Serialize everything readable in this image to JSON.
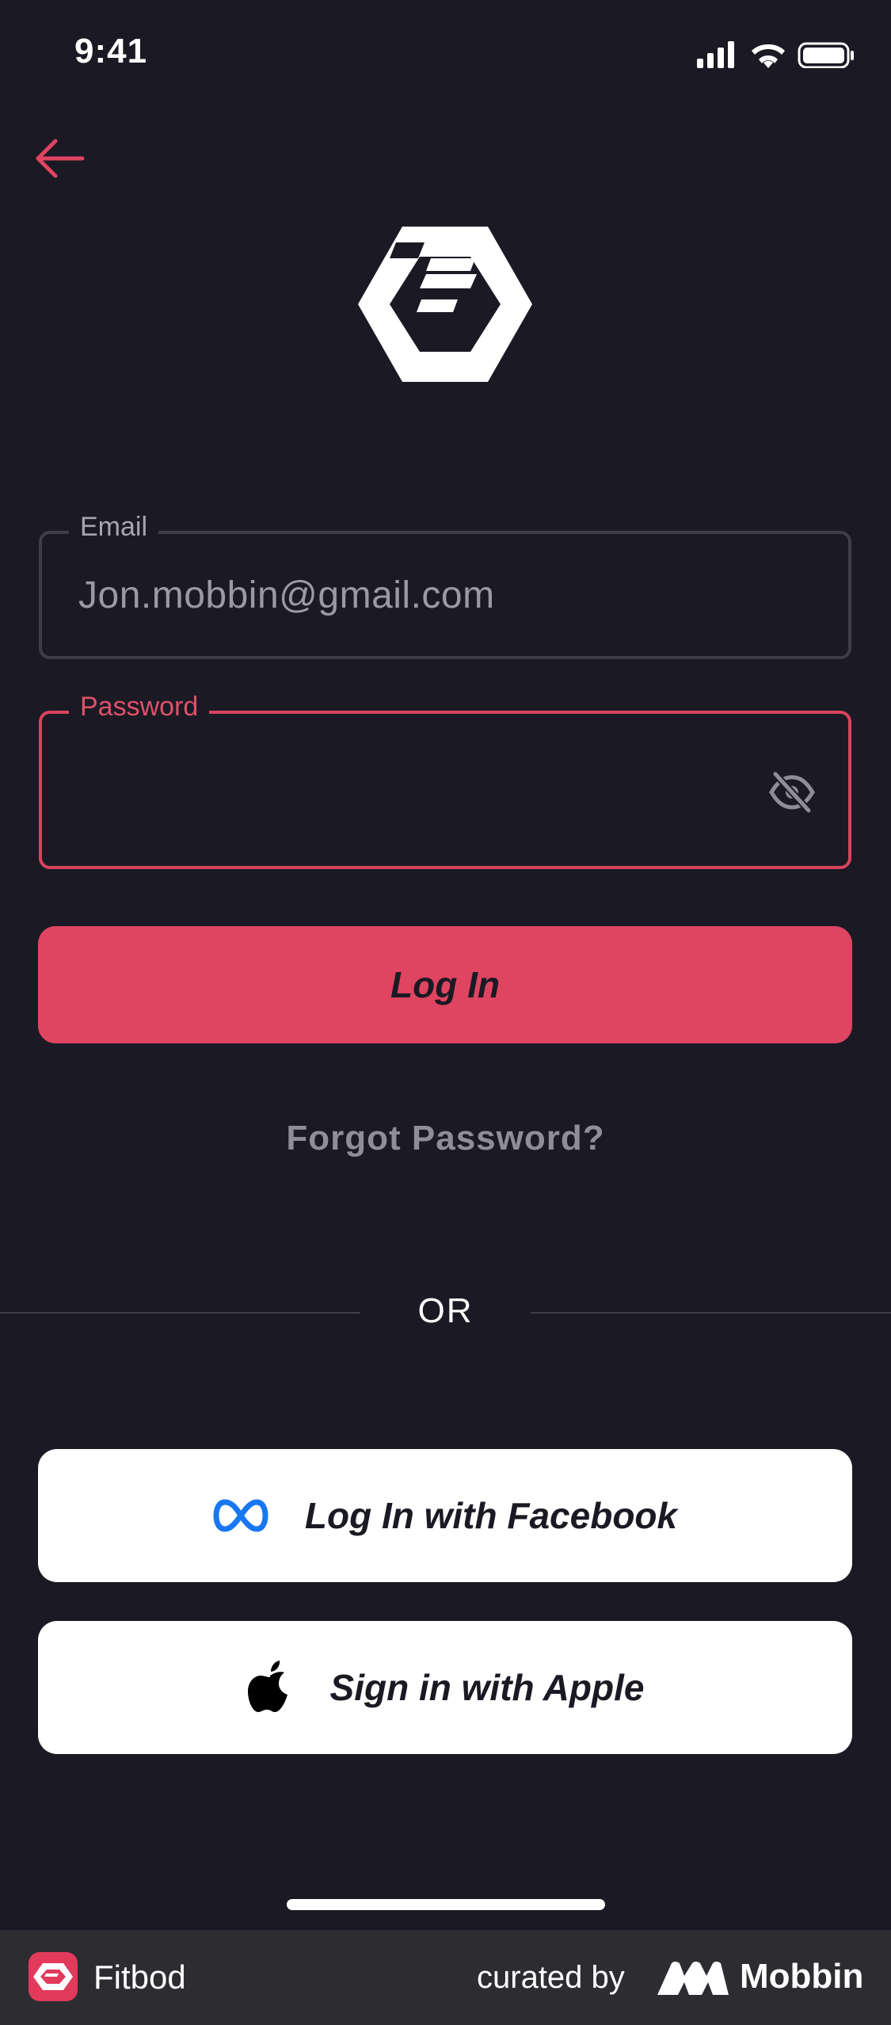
{
  "status_bar": {
    "time": "9:41",
    "icons": [
      "signal-icon",
      "wifi-icon",
      "battery-icon"
    ]
  },
  "nav": {
    "back_icon": "arrow-left-icon"
  },
  "login_form": {
    "email": {
      "label": "Email",
      "value": "Jon.mobbin@gmail.com"
    },
    "password": {
      "label": "Password",
      "value": "",
      "toggle_icon": "eye-off-icon"
    },
    "login_button": "Log In",
    "forgot_link": "Forgot Password?"
  },
  "divider": {
    "text": "OR"
  },
  "social": {
    "facebook_label": "Log In with Facebook",
    "facebook_icon": "meta-icon",
    "apple_label": "Sign in with Apple",
    "apple_icon": "apple-icon"
  },
  "footer": {
    "app_name": "Fitbod",
    "curated_by": "curated by",
    "brand": "Mobbin"
  },
  "colors": {
    "background": "#1b1a24",
    "accent": "#df4460",
    "field_border": "#3e3d4a",
    "muted_text": "#8e8d98",
    "footer_bg": "#2d2c31"
  }
}
